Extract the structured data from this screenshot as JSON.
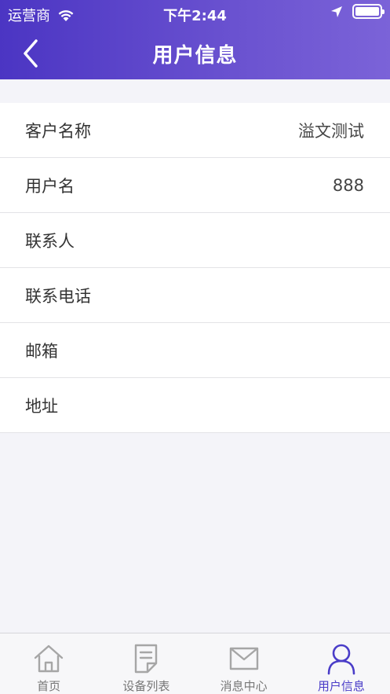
{
  "status_bar": {
    "carrier": "运营商",
    "time": "下午2:44"
  },
  "nav": {
    "title": "用户信息"
  },
  "rows": [
    {
      "label": "客户名称",
      "value": "溢文测试"
    },
    {
      "label": "用户名",
      "value": "888"
    },
    {
      "label": "联系人",
      "value": ""
    },
    {
      "label": "联系电话",
      "value": ""
    },
    {
      "label": "邮箱",
      "value": ""
    },
    {
      "label": "地址",
      "value": ""
    }
  ],
  "tabs": [
    {
      "label": "首页",
      "icon": "home-icon"
    },
    {
      "label": "设备列表",
      "icon": "document-icon"
    },
    {
      "label": "消息中心",
      "icon": "mail-icon"
    },
    {
      "label": "用户信息",
      "icon": "user-icon",
      "active": true
    }
  ],
  "colors": {
    "header_start": "#4b35c3",
    "header_end": "#7b63d8",
    "active_tab": "#4a3dc8",
    "inactive_tab": "#9a9a9a"
  }
}
